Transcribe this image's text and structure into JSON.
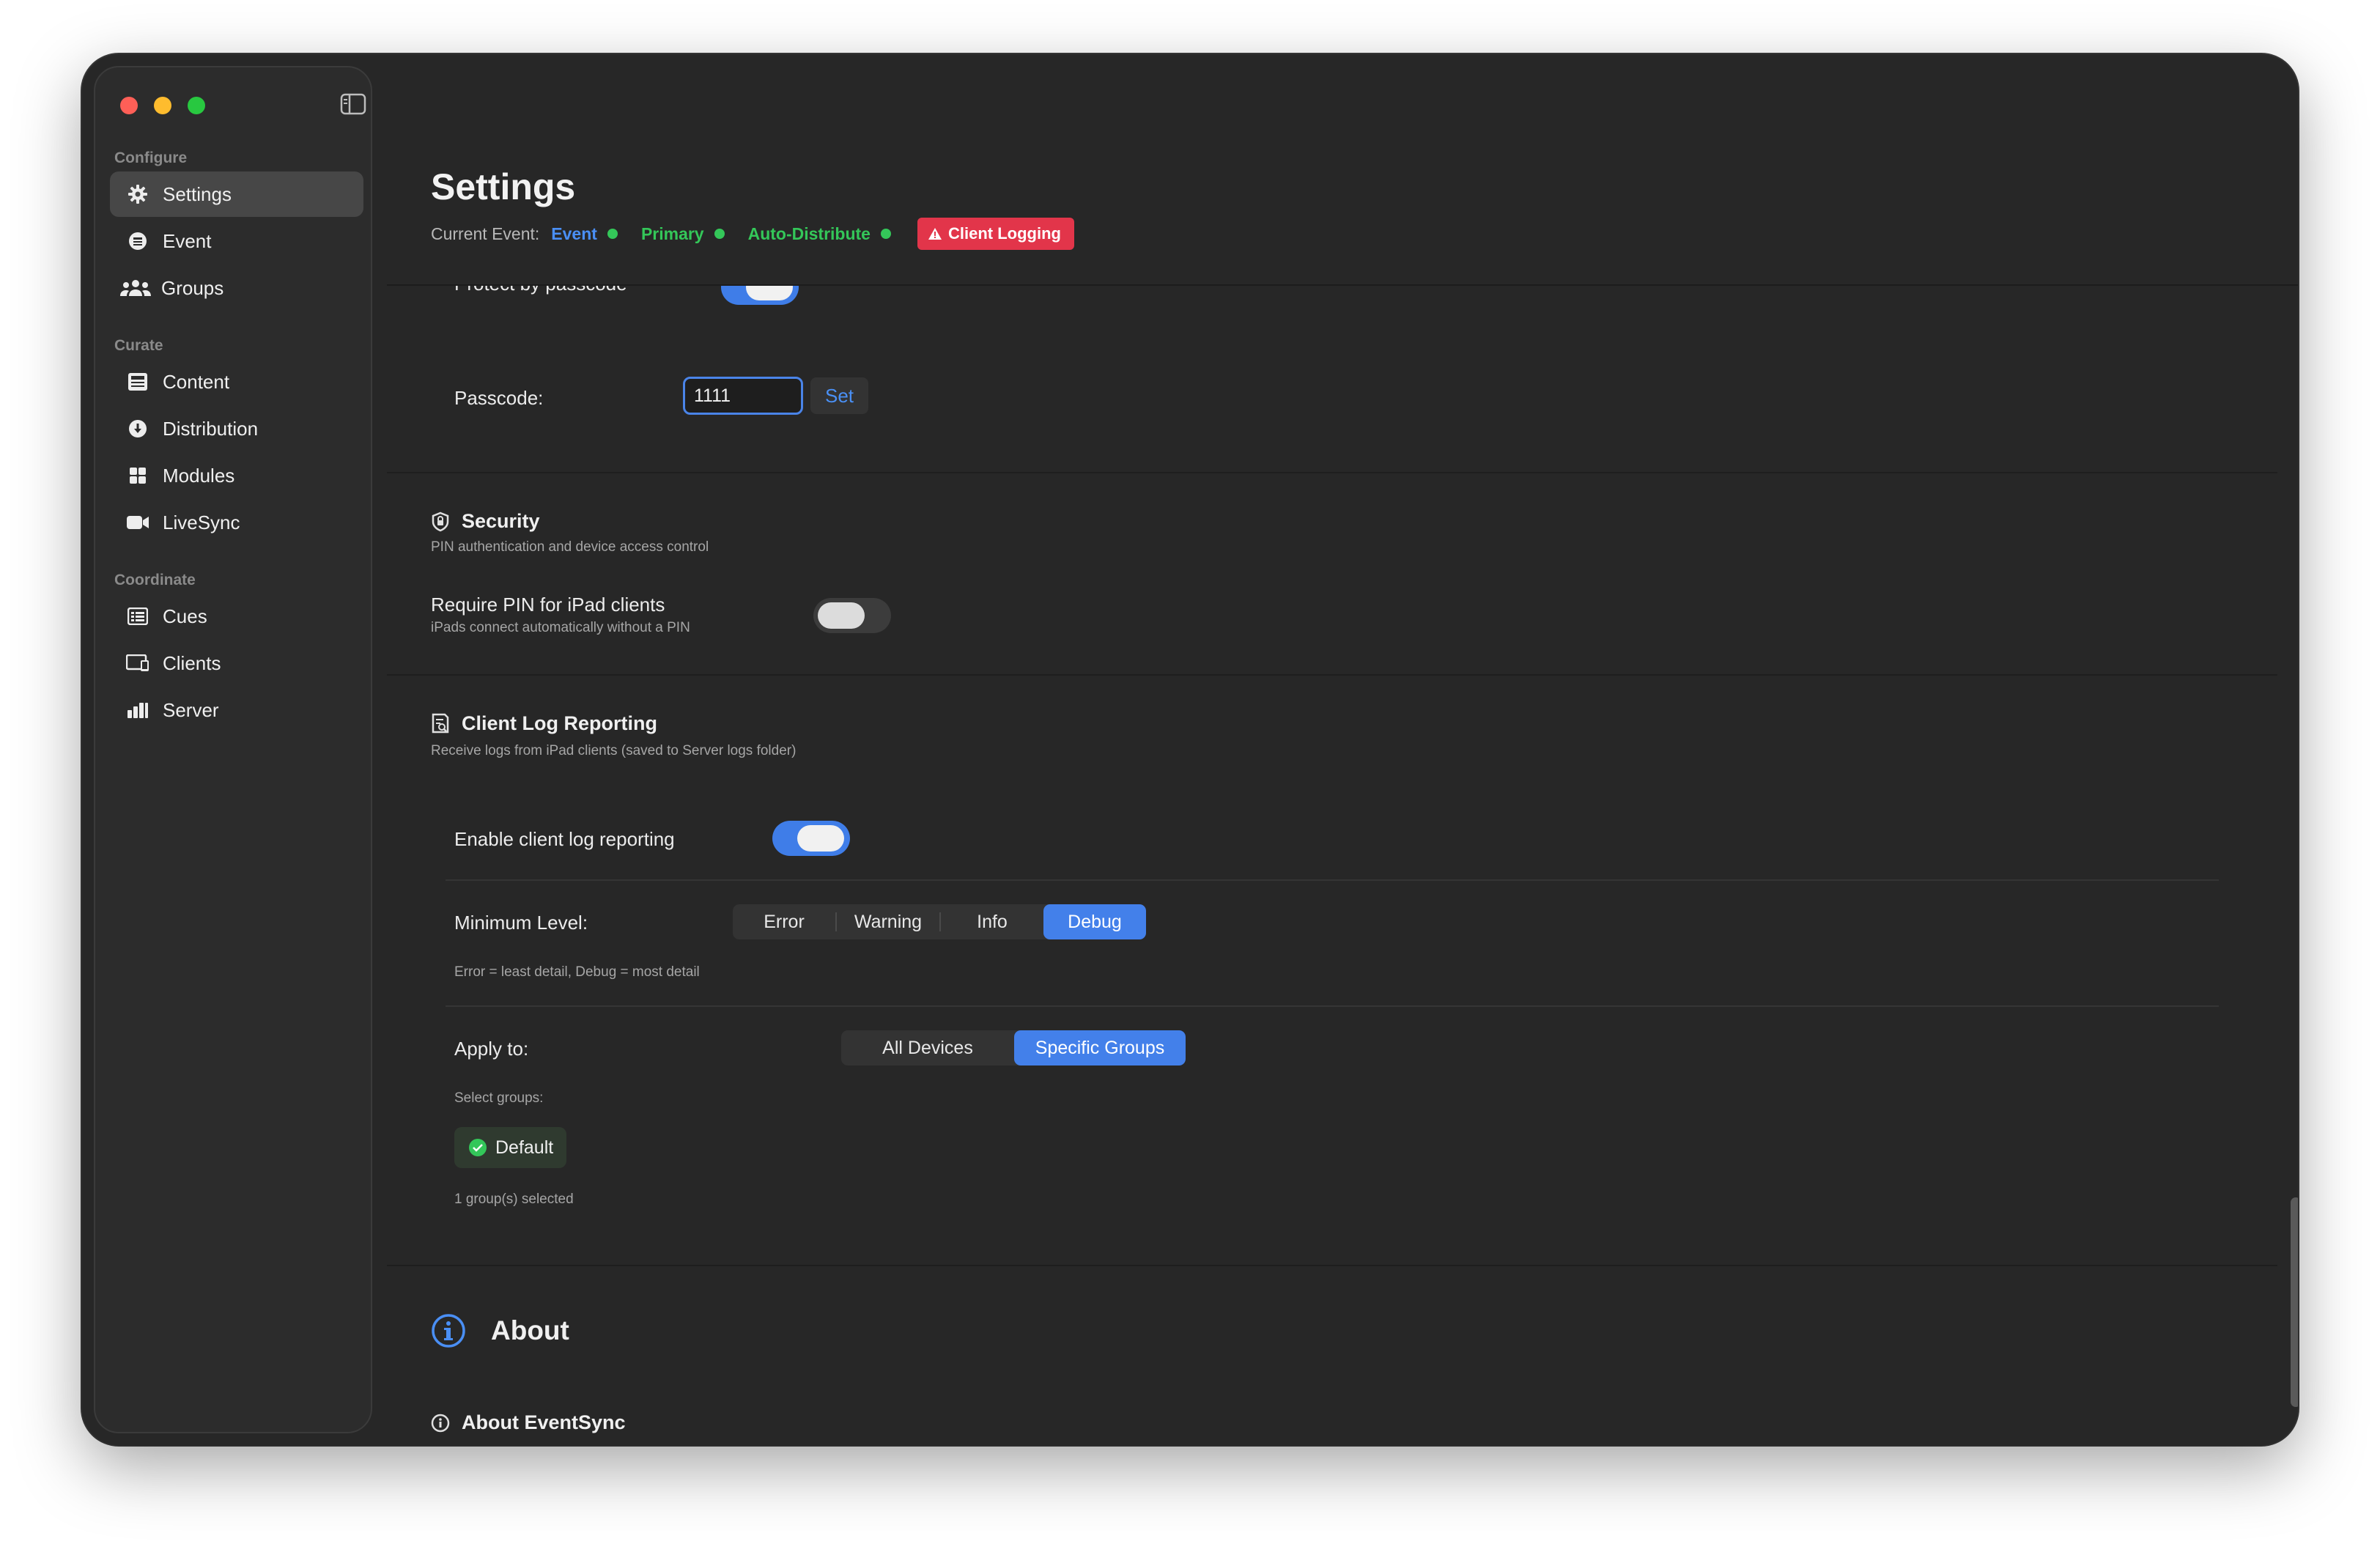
{
  "sidebar": {
    "sections": [
      {
        "label": "Configure"
      },
      {
        "label": "Curate"
      },
      {
        "label": "Coordinate"
      }
    ],
    "items": [
      {
        "label": "Settings",
        "icon": "gear-icon",
        "active": true
      },
      {
        "label": "Event",
        "icon": "calendar-icon"
      },
      {
        "label": "Groups",
        "icon": "people-icon"
      },
      {
        "label": "Content",
        "icon": "content-icon"
      },
      {
        "label": "Distribution",
        "icon": "download-icon"
      },
      {
        "label": "Modules",
        "icon": "grid-icon"
      },
      {
        "label": "LiveSync",
        "icon": "video-icon"
      },
      {
        "label": "Cues",
        "icon": "list-icon"
      },
      {
        "label": "Clients",
        "icon": "devices-icon"
      },
      {
        "label": "Server",
        "icon": "bar-chart-icon"
      }
    ]
  },
  "header": {
    "title": "Settings",
    "current_event_label": "Current Event:",
    "tags": [
      {
        "label": "Event",
        "color": "#4a8ff5"
      },
      {
        "label": "Primary",
        "color": "#34c759"
      },
      {
        "label": "Auto-Distribute",
        "color": "#34c759"
      }
    ],
    "badge": "Client Logging"
  },
  "passcode": {
    "protect_label": "Protect by passcode",
    "label": "Passcode:",
    "value": "1111",
    "set_label": "Set"
  },
  "security": {
    "title": "Security",
    "subtitle": "PIN authentication and device access control",
    "require_pin_label": "Require PIN for iPad clients",
    "require_pin_hint": "iPads connect automatically without a PIN"
  },
  "client_log": {
    "title": "Client Log Reporting",
    "subtitle": "Receive logs from iPad clients (saved to Server logs folder)",
    "enable_label": "Enable client log reporting",
    "min_level_label": "Minimum Level:",
    "levels": [
      "Error",
      "Warning",
      "Info",
      "Debug"
    ],
    "level_hint": "Error = least detail, Debug = most detail",
    "apply_label": "Apply to:",
    "apply_options": [
      "All Devices",
      "Specific Groups"
    ],
    "select_groups_label": "Select groups:",
    "group_chip": "Default",
    "selected_count": "1 group(s) selected"
  },
  "about": {
    "title": "About",
    "subtitle": "About EventSync"
  },
  "colors": {
    "accent": "#4380ea",
    "danger": "#e2354a",
    "success": "#34c759"
  }
}
